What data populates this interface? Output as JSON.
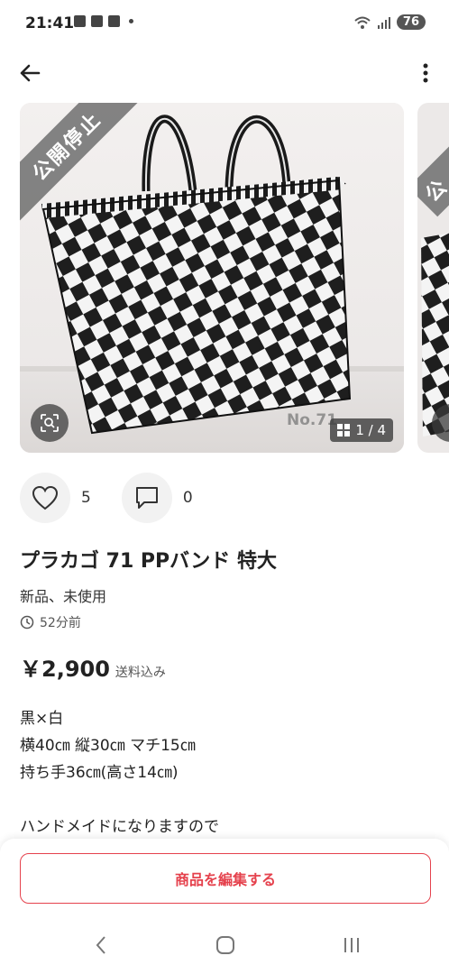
{
  "status_bar": {
    "time": "21:41",
    "battery": "76",
    "icons": [
      "notification-icon",
      "notification-icon",
      "notification-icon",
      "wifi-icon",
      "signal-icon"
    ]
  },
  "header": {
    "back_icon": "back-arrow-icon",
    "menu_icon": "more-vertical-icon"
  },
  "gallery": {
    "ribbon": "公開停止",
    "watermark": "No.71",
    "counter": "1 / 4",
    "zoom_icon": "image-search-icon"
  },
  "actions": {
    "likes": "5",
    "comments": "0",
    "like_icon": "heart-icon",
    "comment_icon": "comment-icon"
  },
  "item": {
    "title": "プラカゴ 71 PPバンド 特大",
    "condition": "新品、未使用",
    "posted": "52分前",
    "price": "￥2,900",
    "shipping": "送料込み"
  },
  "description": {
    "lines": [
      "黒×白",
      "横40㎝ 縦30㎝ マチ15㎝",
      "持ち手36㎝(高さ14㎝)",
      "",
      "ハンドメイドになりますので"
    ]
  },
  "bottom": {
    "edit_button": "商品を編集する"
  },
  "colors": {
    "accent": "#e5424d",
    "text": "#222222",
    "sub_text": "#555555"
  }
}
